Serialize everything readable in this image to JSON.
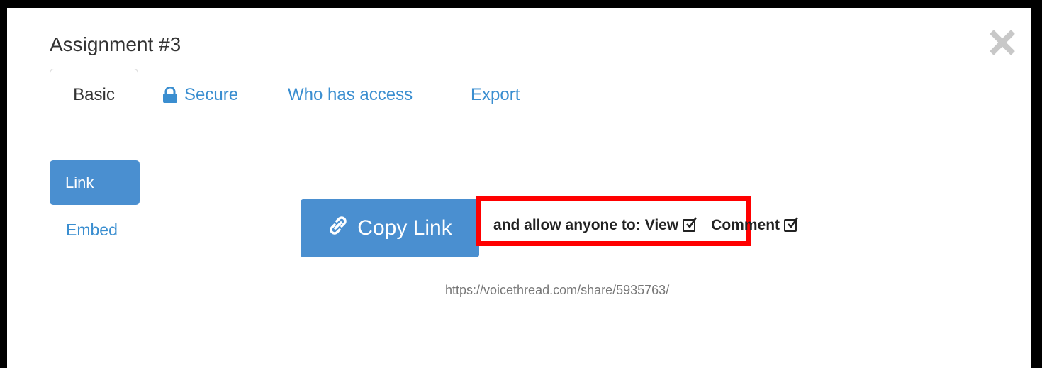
{
  "dialog": {
    "title": "Assignment #3",
    "close_icon": "close-icon"
  },
  "tabs": [
    {
      "label": "Basic",
      "active": true
    },
    {
      "label": "Secure",
      "icon": "lock-icon"
    },
    {
      "label": "Who has access"
    },
    {
      "label": "Export"
    }
  ],
  "sidebar": {
    "link_label": "Link",
    "embed_label": "Embed"
  },
  "main": {
    "copy_button_label": "Copy Link",
    "copy_icon": "link-icon",
    "permission_text": "and allow anyone to:",
    "view_label": "View",
    "view_checked": true,
    "comment_label": "Comment",
    "comment_checked": true,
    "share_url": "https://voicethread.com/share/5935763/"
  },
  "colors": {
    "accent": "#4a8fd0",
    "link": "#3a8ed0",
    "highlight": "#ff0000"
  }
}
